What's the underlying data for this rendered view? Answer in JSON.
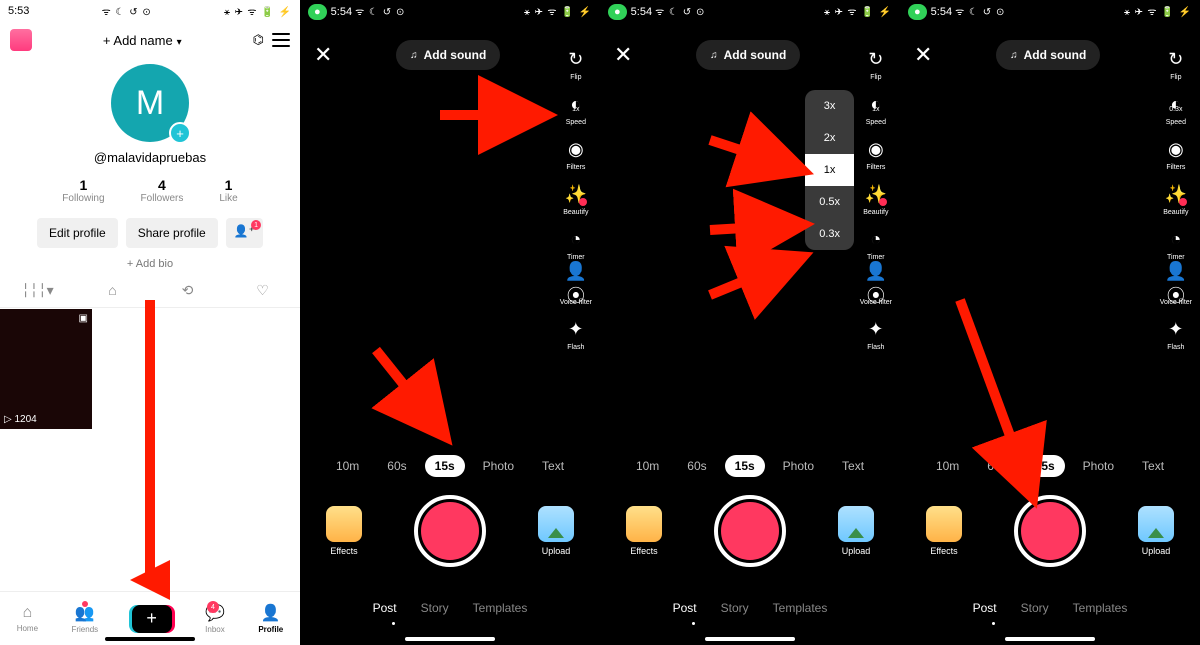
{
  "panel1": {
    "time": "5:53",
    "status_left_icons": "ᯤ ☾ ↺ ⊙",
    "status_right_icons": "⚹ ✈ ᯤ 🔋 ⚡",
    "add_name": "+ Add name",
    "avatar_initial": "M",
    "handle": "@malavidapruebas",
    "stats": [
      {
        "n": "1",
        "l": "Following"
      },
      {
        "n": "4",
        "l": "Followers"
      },
      {
        "n": "1",
        "l": "Like"
      }
    ],
    "edit_profile": "Edit profile",
    "share_profile": "Share profile",
    "add_friend_badge": "1",
    "add_bio": "+ Add bio",
    "thumb_plays": "▷ 1204",
    "bottom_tabs": {
      "home": "Home",
      "friends": "Friends",
      "inbox": "Inbox",
      "inbox_badge": "4",
      "profile": "Profile"
    }
  },
  "camera": {
    "time": "5:54",
    "status_left_icons": "ᯤ ☾ ↺ ⊙",
    "status_right_icons": "⚹ ✈ ᯤ 🔋 ⚡",
    "add_sound": "Add sound",
    "tools": {
      "flip": "Flip",
      "speed": "Speed",
      "filters": "Filters",
      "beautify": "Beautify",
      "timer": "Timer",
      "voice_filter": "Voice filter",
      "flash": "Flash"
    },
    "speed_label_default": "1x",
    "speed_label_panel4": "0.3x",
    "speed_options": [
      "3x",
      "2x",
      "1x",
      "0.5x",
      "0.3x"
    ],
    "speed_selected": "1x",
    "durations": [
      "10m",
      "60s",
      "15s",
      "Photo",
      "Text"
    ],
    "duration_selected": "15s",
    "effects": "Effects",
    "upload": "Upload",
    "post_tabs": [
      "Post",
      "Story",
      "Templates"
    ]
  }
}
